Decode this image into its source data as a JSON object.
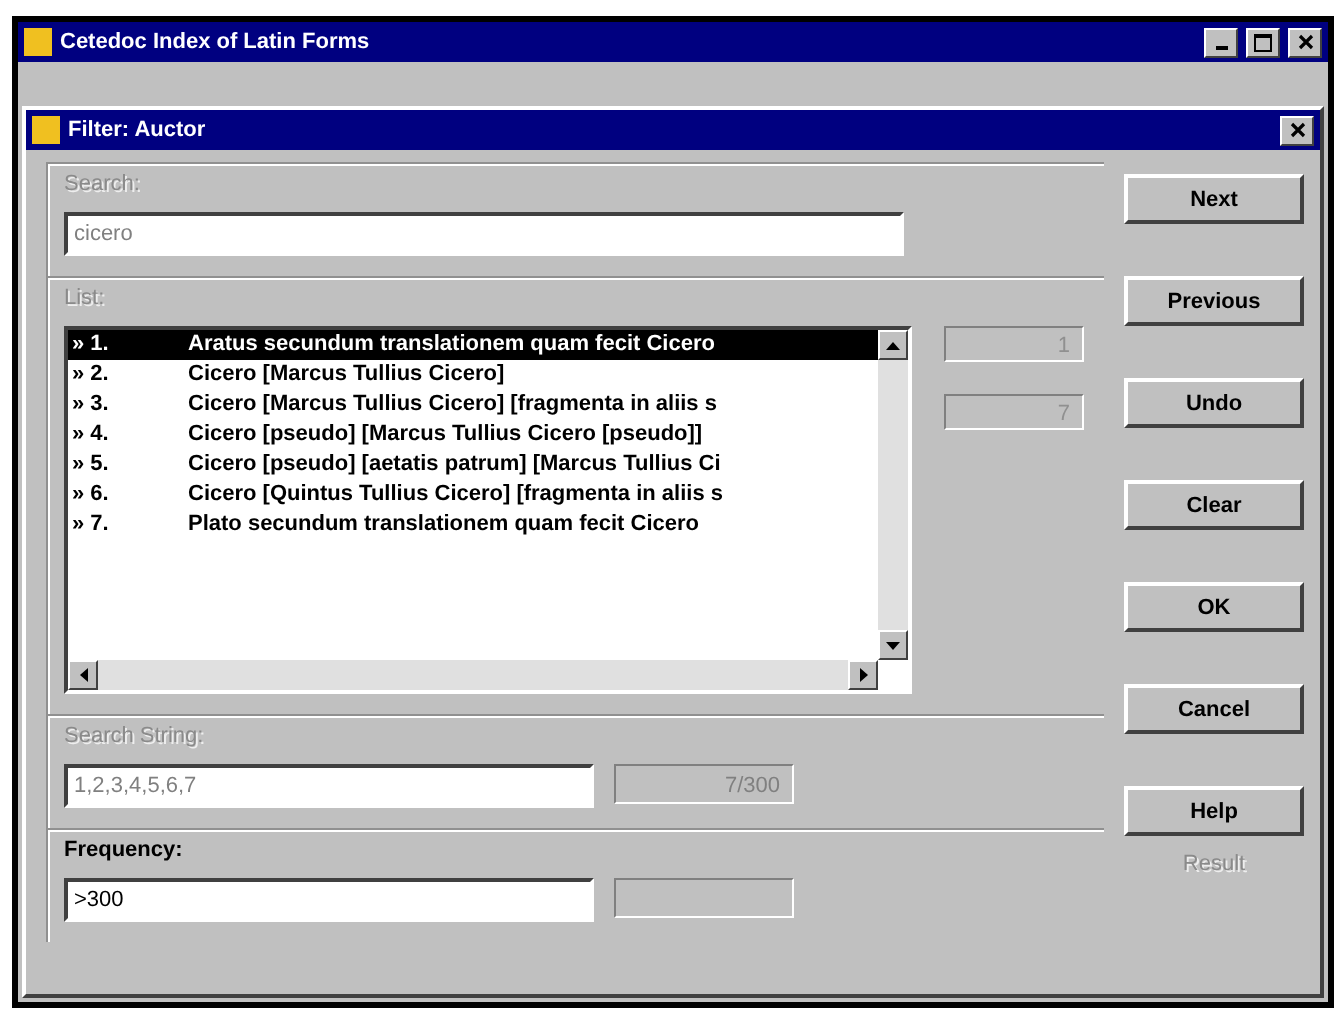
{
  "window": {
    "title": "Cetedoc Index of Latin Forms"
  },
  "dialog": {
    "title": "Filter: Auctor"
  },
  "search": {
    "label": "Search:",
    "label_disabled": true,
    "value": "cicero",
    "disabled": true
  },
  "list": {
    "label": "List:",
    "label_disabled": true,
    "items": [
      {
        "bullet": "»",
        "number": "1.",
        "text": "Aratus secundum translationem quam fecit Cicero",
        "selected": true
      },
      {
        "bullet": "»",
        "number": "2.",
        "text": "Cicero [Marcus Tullius Cicero]",
        "selected": false
      },
      {
        "bullet": "»",
        "number": "3.",
        "text": "Cicero [Marcus Tullius Cicero] [fragmenta in aliis s",
        "selected": false
      },
      {
        "bullet": "»",
        "number": "4.",
        "text": "Cicero [pseudo] [Marcus Tullius Cicero [pseudo]]",
        "selected": false
      },
      {
        "bullet": "»",
        "number": "5.",
        "text": "Cicero [pseudo] [aetatis patrum] [Marcus Tullius Ci",
        "selected": false
      },
      {
        "bullet": "»",
        "number": "6.",
        "text": "Cicero [Quintus Tullius Cicero] [fragmenta in aliis s",
        "selected": false
      },
      {
        "bullet": "»",
        "number": "7.",
        "text": "Plato secundum translationem quam fecit Cicero",
        "selected": false
      }
    ],
    "side_fields": [
      {
        "value": "1",
        "disabled": true
      },
      {
        "value": "7",
        "disabled": true
      }
    ]
  },
  "search_string": {
    "label": "Search String:",
    "label_disabled": true,
    "value": "1,2,3,4,5,6,7",
    "disabled": true,
    "count": "7/300"
  },
  "frequency": {
    "label": "Frequency:",
    "label_disabled": false,
    "value": ">300",
    "disabled": false
  },
  "result": {
    "label": "Result",
    "label_disabled": true
  },
  "buttons": [
    "Next",
    "Previous",
    "Undo",
    "Clear",
    "OK",
    "Cancel",
    "Help"
  ]
}
